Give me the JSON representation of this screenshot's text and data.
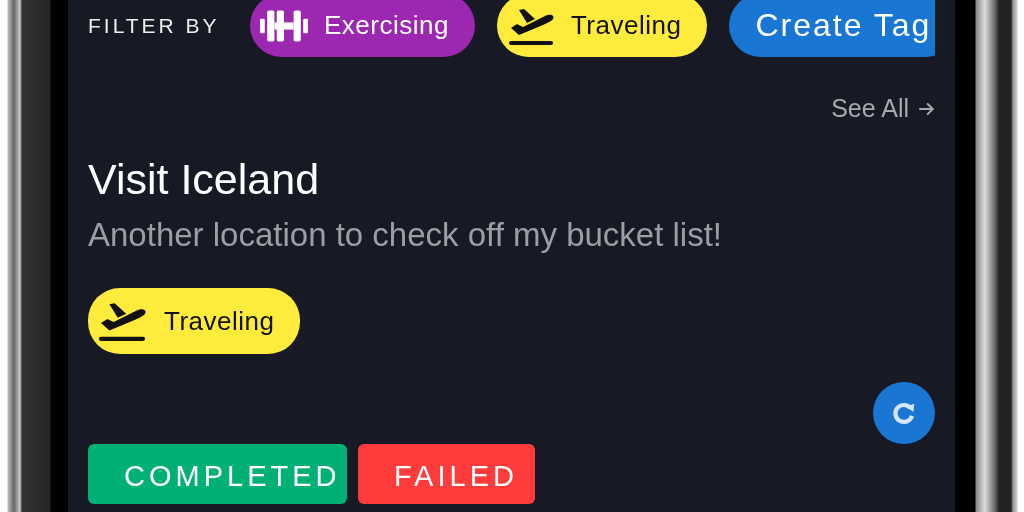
{
  "filter_label": "FILTER BY",
  "filters": [
    {
      "kind": "exercise",
      "label": "Exercising",
      "color": "#9c27b0"
    },
    {
      "kind": "travel",
      "label": "Traveling",
      "color": "#ffeb3b"
    },
    {
      "kind": "create",
      "label": "Create Tag",
      "color": "#1976d2"
    }
  ],
  "see_all": "See All",
  "card": {
    "title": "Visit Iceland",
    "subtitle": "Another location to check off my bucket list!",
    "tags": [
      {
        "kind": "travel",
        "label": "Traveling",
        "color": "#ffeb3b"
      }
    ]
  },
  "actions": [
    {
      "kind": "complete",
      "label": "COMPLETED"
    },
    {
      "kind": "fail",
      "label": "FAILED"
    }
  ]
}
